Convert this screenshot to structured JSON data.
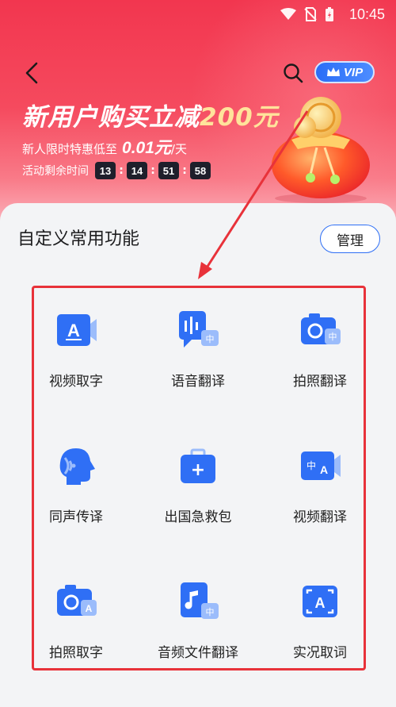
{
  "status_bar": {
    "time": "10:45"
  },
  "nav": {
    "vip_label": "VIP"
  },
  "promo": {
    "title_prefix": "新用户购买立减",
    "title_highlight": "200元",
    "subtitle_prefix": "新人限时特惠低至",
    "subtitle_price": "0.01元",
    "subtitle_suffix": "/天",
    "countdown_label": "活动剩余时间",
    "countdown": [
      "13",
      "14",
      "51",
      "58"
    ]
  },
  "section": {
    "title": "自定义常用功能",
    "manage_label": "管理"
  },
  "features": [
    {
      "label": "视频取字",
      "icon": "video-text-icon"
    },
    {
      "label": "语音翻译",
      "icon": "voice-translate-icon"
    },
    {
      "label": "拍照翻译",
      "icon": "photo-translate-icon"
    },
    {
      "label": "同声传译",
      "icon": "simultaneous-interpretation-icon"
    },
    {
      "label": "出国急救包",
      "icon": "first-aid-kit-icon"
    },
    {
      "label": "视频翻译",
      "icon": "video-translate-icon"
    },
    {
      "label": "拍照取字",
      "icon": "photo-text-icon"
    },
    {
      "label": "音频文件翻译",
      "icon": "audio-file-translate-icon"
    },
    {
      "label": "实况取词",
      "icon": "live-text-icon"
    }
  ],
  "colors": {
    "accent_blue": "#2f6ff5",
    "banner_red": "#f2364f",
    "highlight_frame": "#e8323a",
    "price_gold": "#ffe39b"
  },
  "icon_glyphs": {
    "icon_a": "A",
    "icon_zh": "中",
    "icon_plus": "+"
  }
}
